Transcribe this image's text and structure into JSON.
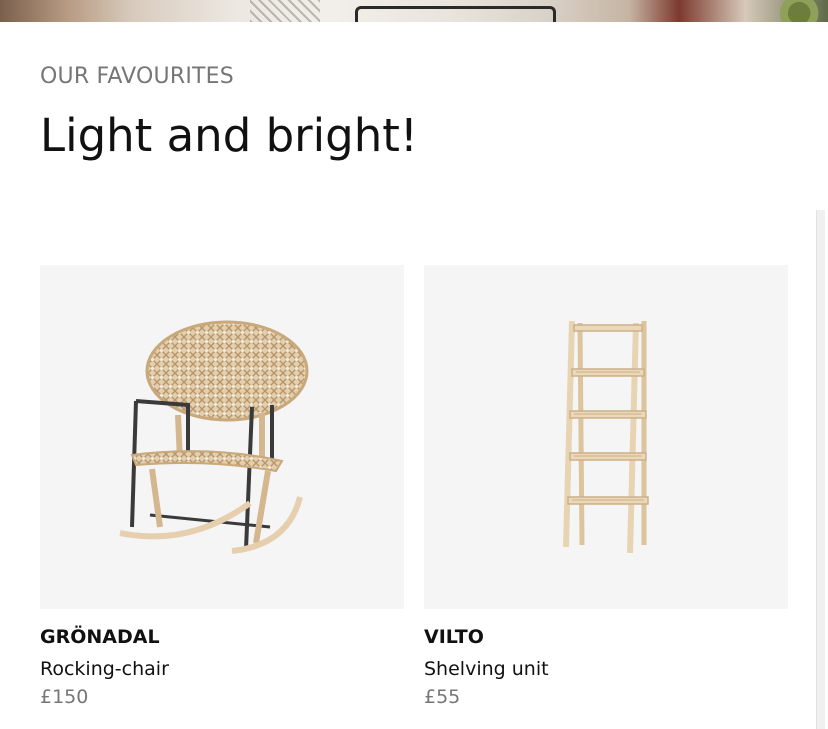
{
  "section": {
    "eyebrow": "OUR FAVOURITES",
    "title": "Light and bright!"
  },
  "products": [
    {
      "name": "GRÖNADAL",
      "description": "Rocking-chair",
      "price": "£150",
      "image": "rocking-chair"
    },
    {
      "name": "VILTO",
      "description": "Shelving unit",
      "price": "£55",
      "image": "shelving-unit"
    }
  ],
  "colors": {
    "text": "#111111",
    "muted": "#767676",
    "image_bg": "#f5f5f5"
  }
}
